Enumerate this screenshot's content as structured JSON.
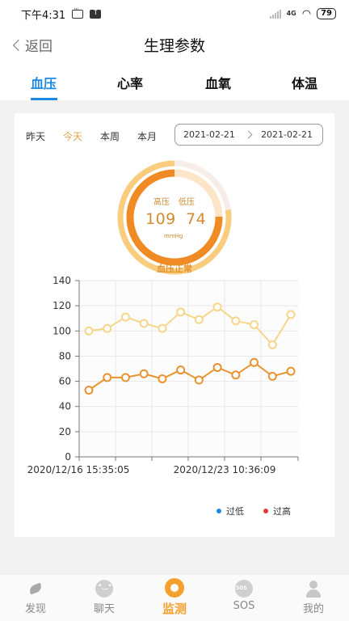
{
  "status_bar": {
    "time": "下午4:31",
    "network": "4G",
    "battery": "79"
  },
  "header": {
    "back_label": "返回",
    "title": "生理参数"
  },
  "tabs": [
    {
      "label": "血压",
      "active": true
    },
    {
      "label": "心率",
      "active": false
    },
    {
      "label": "血氧",
      "active": false
    },
    {
      "label": "体温",
      "active": false
    }
  ],
  "period_filters": [
    {
      "label": "昨天",
      "active": false
    },
    {
      "label": "今天",
      "active": true
    },
    {
      "label": "本周",
      "active": false
    },
    {
      "label": "本月",
      "active": false
    }
  ],
  "date_range": {
    "start": "2021-02-21",
    "end": "2021-02-21"
  },
  "gauge": {
    "high_label": "高压",
    "low_label": "低压",
    "high_value": "109",
    "low_value": "74",
    "unit": "mmHg",
    "status": "血压正常"
  },
  "colors": {
    "accent": "#1e88e5",
    "systolic": "#f7d58a",
    "diastolic": "#e8932f",
    "legend_low": "#1e88e5",
    "legend_high": "#e53935",
    "active_period": "#e3a445"
  },
  "chart_data": {
    "type": "line",
    "x_tick_labels": [
      "2020/12/16 15:35:05",
      "2020/12/23 10:36:09"
    ],
    "y_ticks": [
      0,
      20,
      40,
      60,
      80,
      100,
      120,
      140
    ],
    "ylim": [
      0,
      140
    ],
    "series": [
      {
        "values": [
          100,
          102,
          111,
          106,
          102,
          115,
          109,
          119,
          108,
          105,
          89,
          113
        ]
      },
      {
        "values": [
          53,
          63,
          63,
          66,
          62,
          69,
          61,
          71,
          65,
          75,
          64,
          68
        ]
      }
    ],
    "legend": [
      {
        "name": "过低"
      },
      {
        "name": "过高"
      }
    ]
  },
  "bottom_nav": [
    {
      "label": "发现",
      "icon": "bird-icon",
      "active": false
    },
    {
      "label": "聊天",
      "icon": "chat-icon",
      "active": false
    },
    {
      "label": "监测",
      "icon": "monitor-icon",
      "active": true
    },
    {
      "label": "SOS",
      "icon": "sos-icon",
      "active": false
    },
    {
      "label": "我的",
      "icon": "user-icon",
      "active": false
    }
  ]
}
